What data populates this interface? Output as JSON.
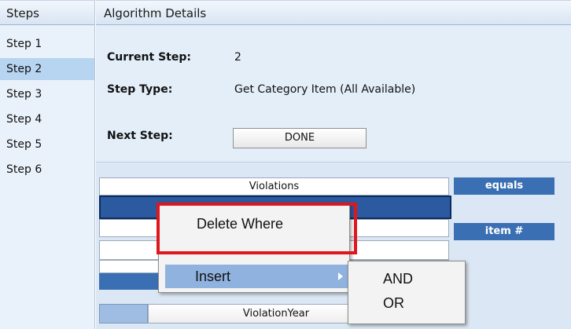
{
  "steps_panel": {
    "title": "Steps",
    "items": [
      {
        "label": "Step 1",
        "selected": false
      },
      {
        "label": "Step 2",
        "selected": true
      },
      {
        "label": "Step 3",
        "selected": false
      },
      {
        "label": "Step 4",
        "selected": false
      },
      {
        "label": "Step 5",
        "selected": false
      },
      {
        "label": "Step 6",
        "selected": false
      }
    ]
  },
  "details": {
    "title": "Algorithm Details",
    "current_step_label": "Current Step:",
    "current_step_value": "2",
    "step_type_label": "Step Type:",
    "step_type_value": "Get Category Item (All Available)",
    "next_step_label": "Next Step:",
    "next_step_value": "DONE"
  },
  "where_grid": {
    "field1": "Violations",
    "operator1": "equals",
    "operator2": "item #",
    "field_last": "ViolationYear"
  },
  "context_menu": {
    "delete_where": "Delete Where",
    "insert": "Insert",
    "submenu": [
      "AND",
      "OR"
    ]
  },
  "colors": {
    "accent_blue": "#3a70b3",
    "highlight_red": "#e0161d",
    "menu_hover": "#8fb2de"
  }
}
